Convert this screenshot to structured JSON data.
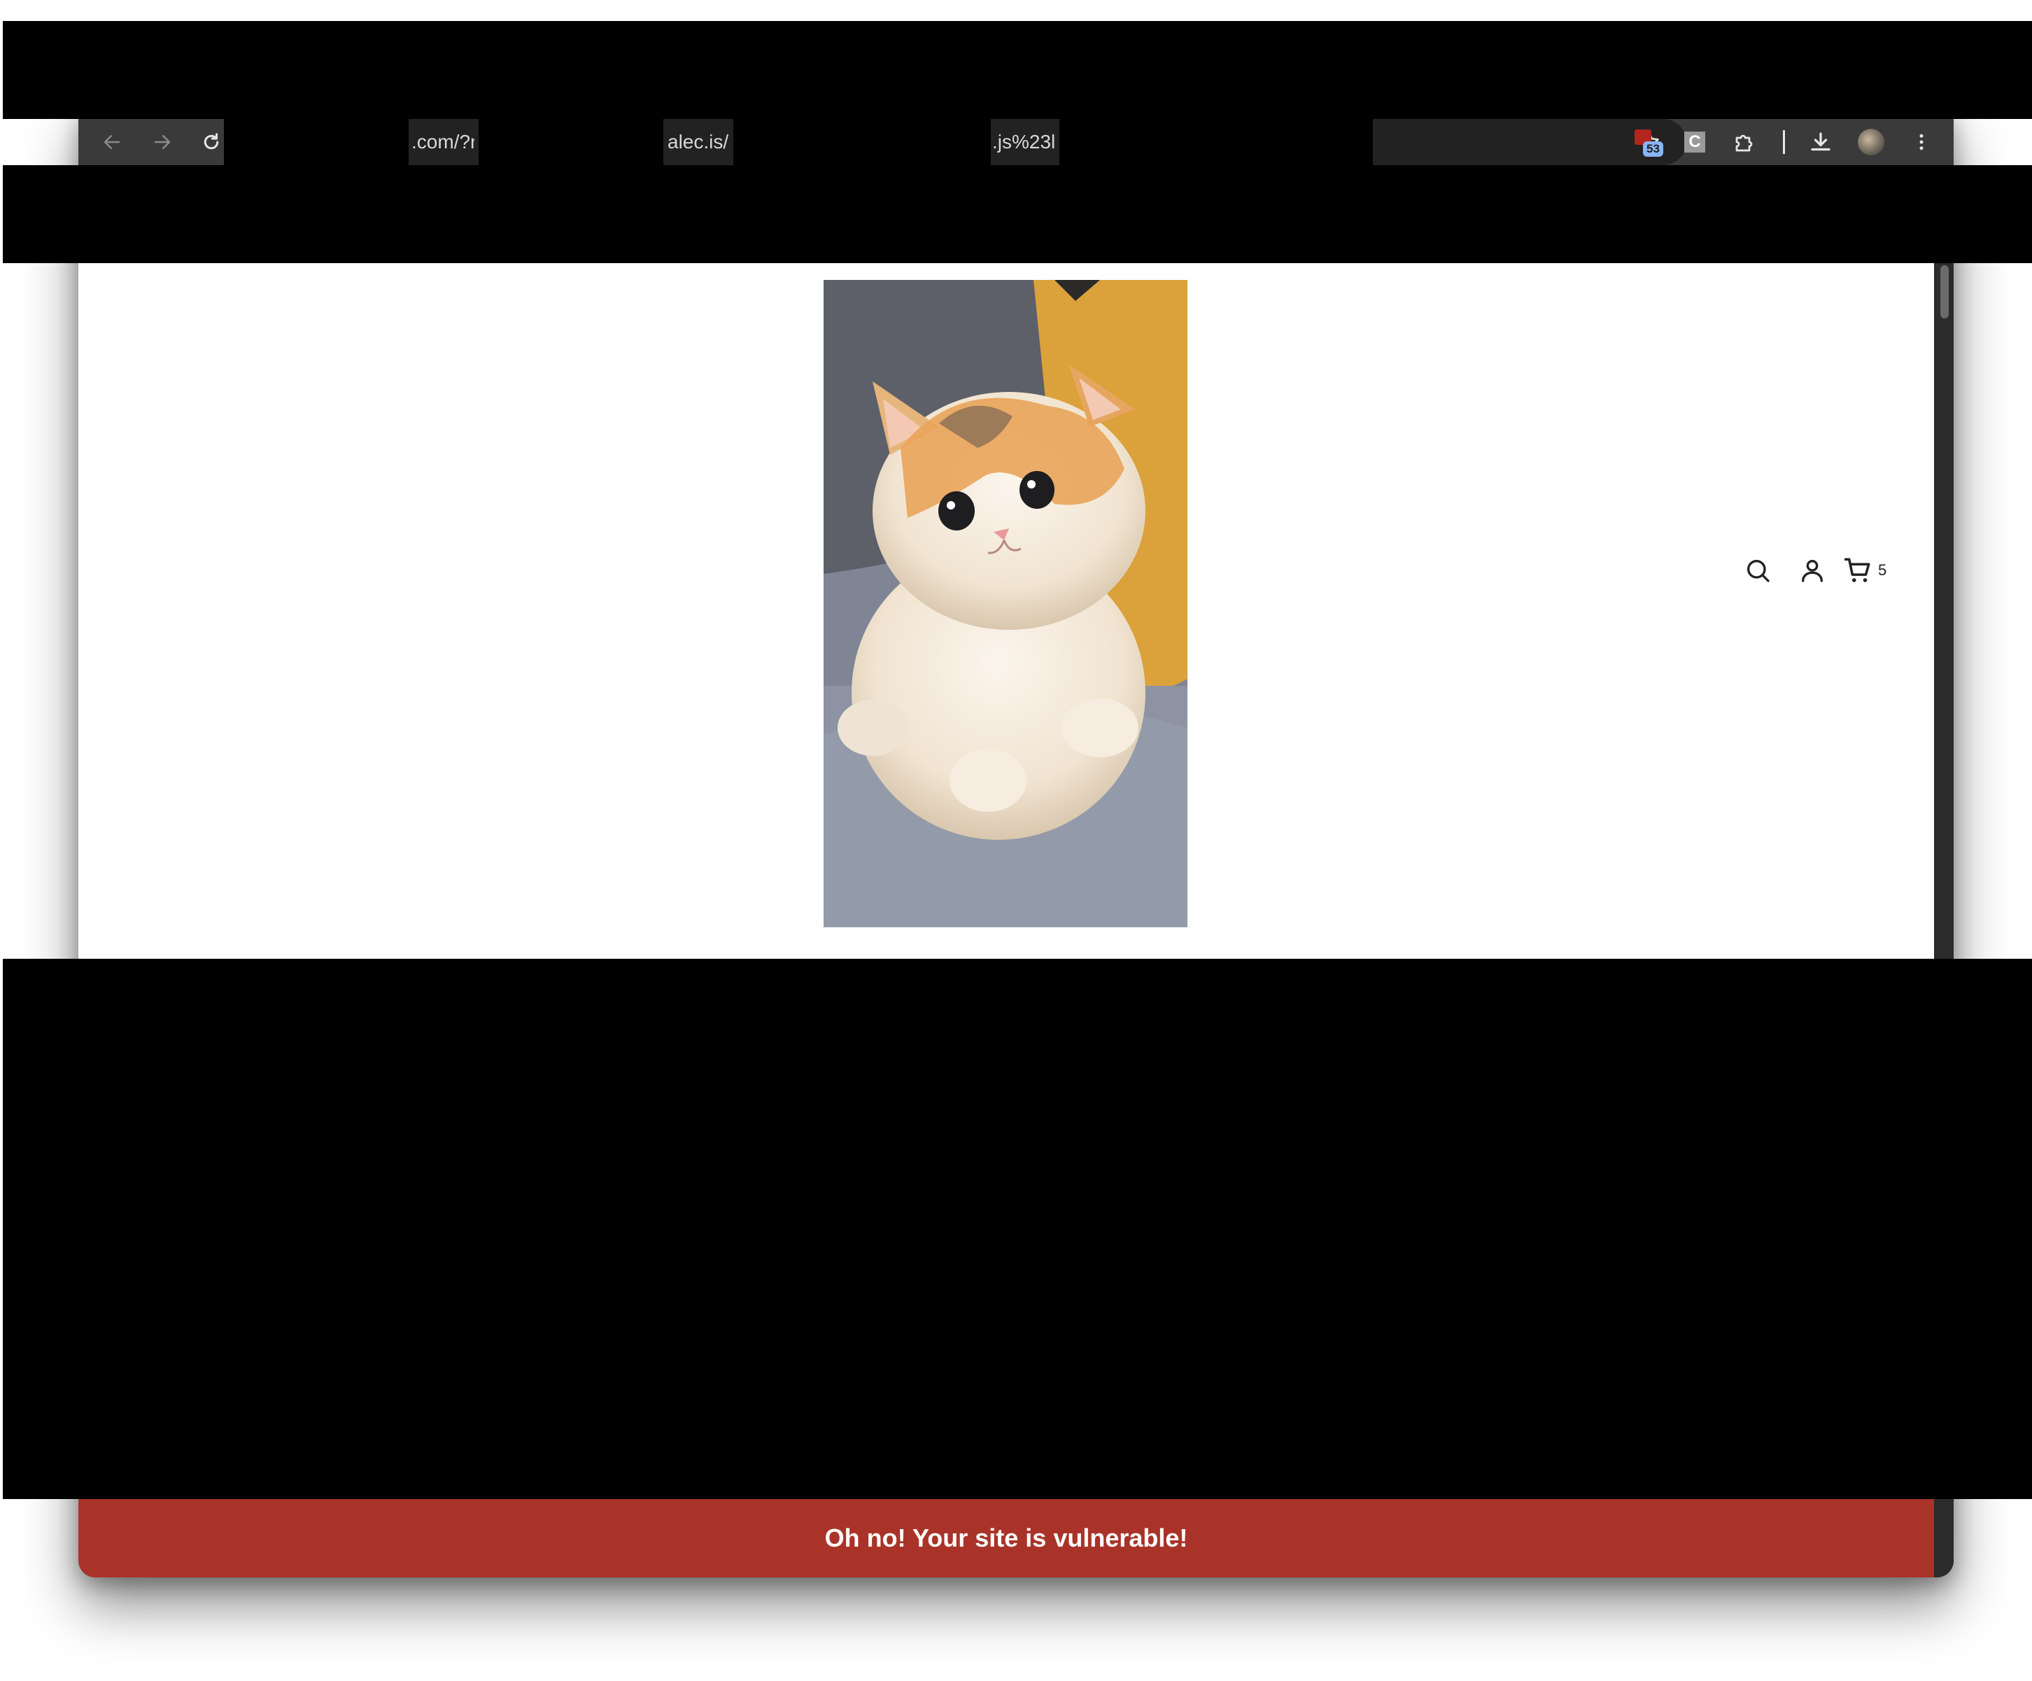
{
  "browser": {
    "url_segments": [
      ".com/?r",
      "alec.is/",
      ".js%23l"
    ],
    "extensions_badge": "53",
    "extension_c_label": "C"
  },
  "site": {
    "header": {
      "cart_count": "5"
    },
    "hero_image_alt": "kitten",
    "banner": {
      "text": "Oh no! Your site is vulnerable!"
    }
  },
  "colors": {
    "banner": "#a93328",
    "page_bg": "#ffffff",
    "toolbar_bg": "#3a3a3a"
  }
}
